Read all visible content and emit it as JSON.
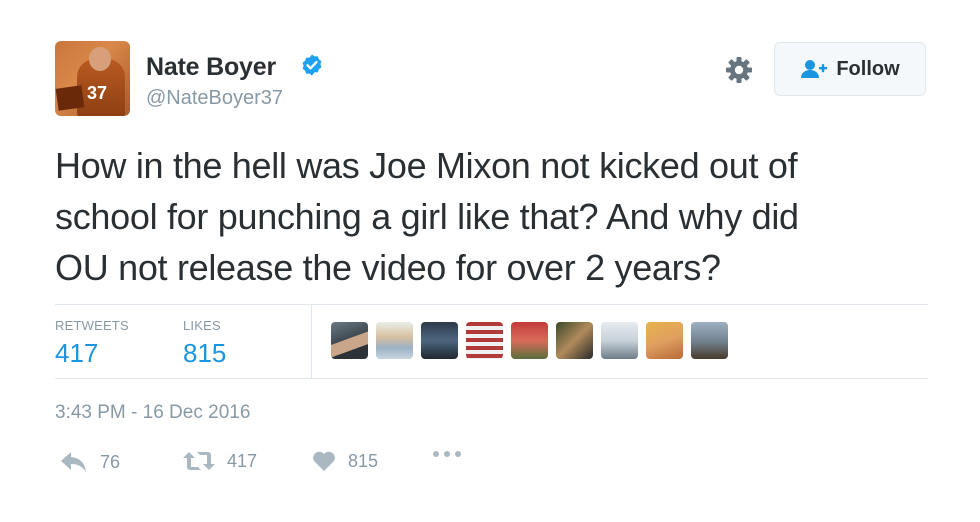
{
  "user": {
    "name": "Nate Boyer",
    "handle": "@NateBoyer37",
    "avatar_jersey_number": "37"
  },
  "follow_button": {
    "label": "Follow"
  },
  "tweet": {
    "lines": [
      "How in the hell was Joe Mixon not kicked out of",
      "school for punching a girl like that? And why did",
      "OU not release the video for over 2 years?"
    ]
  },
  "stats": {
    "retweets_label": "RETWEETS",
    "retweets_value": "417",
    "likes_label": "LIKES",
    "likes_value": "815"
  },
  "likers_count": 9,
  "timestamp": "3:43 PM - 16 Dec 2016",
  "actions": {
    "reply_count": "76",
    "retweet_count": "417",
    "like_count": "815"
  },
  "colors": {
    "accent_blue": "#1b95e0",
    "muted_gray": "#8899a6",
    "text_dark": "#292f33",
    "verified_blue": "#1da1f2"
  },
  "icons": [
    "verified-badge-icon",
    "gear-icon",
    "follow-person-icon",
    "reply-icon",
    "retweet-icon",
    "heart-icon",
    "more-dots-icon"
  ]
}
